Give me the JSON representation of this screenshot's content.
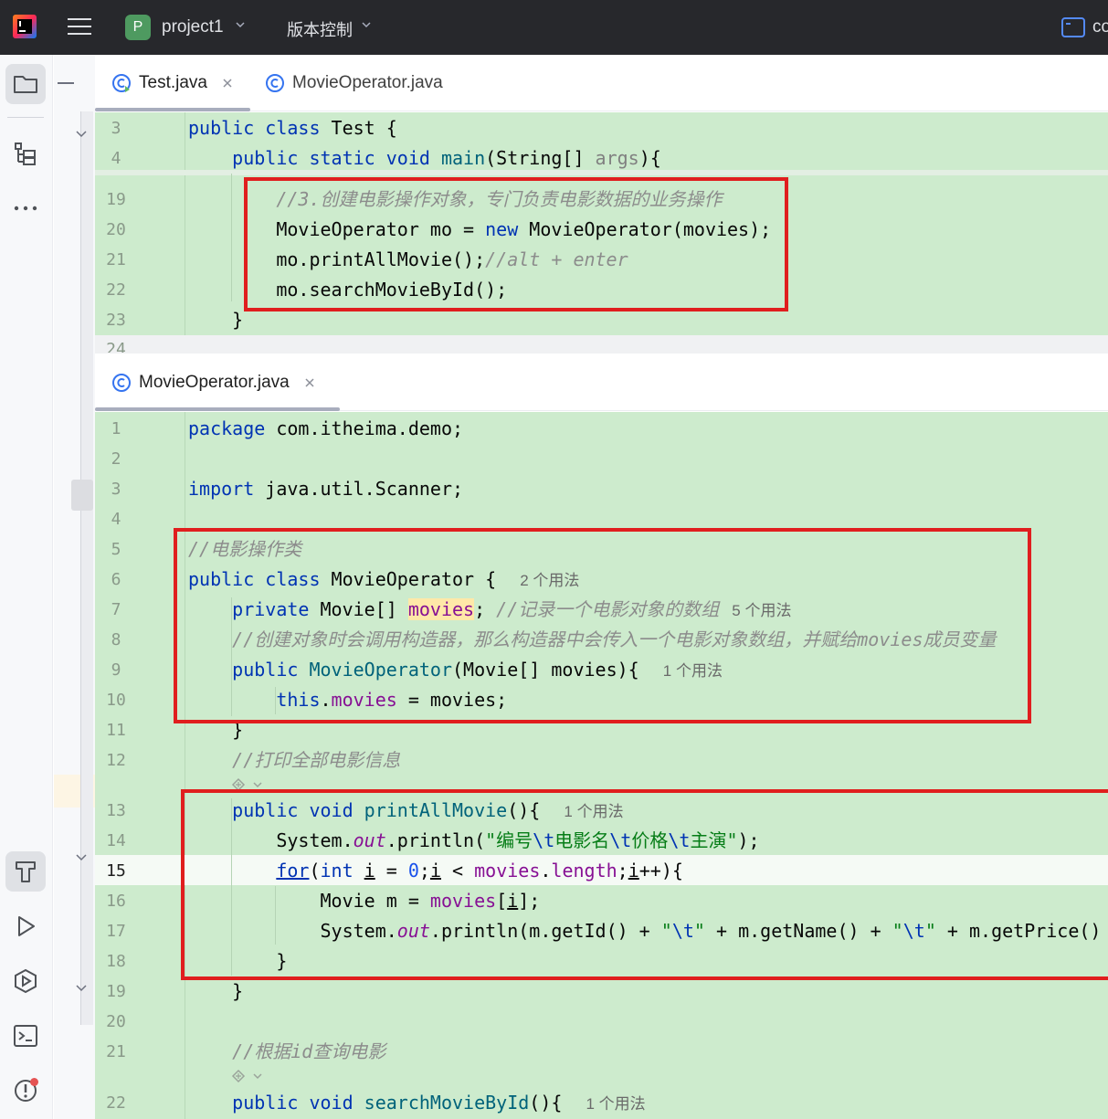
{
  "titlebar": {
    "project_badge": "P",
    "project_name": "project1",
    "vcs_label": "版本控制",
    "edge_text": "co"
  },
  "top_editor": {
    "tabs": [
      {
        "label": "Test.java",
        "active": true,
        "closable": true
      },
      {
        "label": "MovieOperator.java",
        "active": false,
        "closable": false
      }
    ],
    "line_numbers": [
      "3",
      "4",
      "19",
      "20",
      "21",
      "22",
      "23",
      "24"
    ]
  },
  "bottom_editor": {
    "tabs": [
      {
        "label": "MovieOperator.java",
        "active": true,
        "closable": true
      }
    ],
    "line_numbers": [
      "1",
      "2",
      "3",
      "4",
      "5",
      "6",
      "7",
      "8",
      "9",
      "10",
      "11",
      "12",
      "13",
      "14",
      "15",
      "16",
      "17",
      "18",
      "19",
      "20",
      "21",
      "22"
    ],
    "usage_hints": {
      "line6": "2 个用法",
      "line7": "5 个用法",
      "line9": "1 个用法",
      "line13": "1 个用法",
      "line22": "1 个用法"
    }
  },
  "colors": {
    "code_background": "#cdebcd",
    "keyword": "#0033b3",
    "annotation_box": "#e01e1e"
  }
}
